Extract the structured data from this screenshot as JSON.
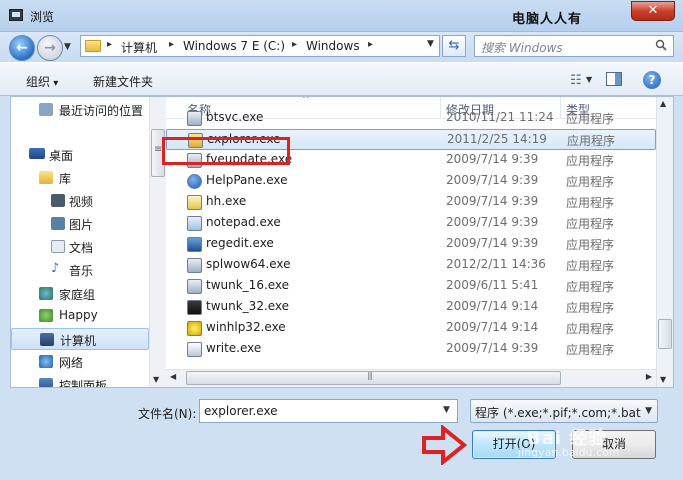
{
  "window": {
    "title": "浏览",
    "watermark_title": "电脑人人有",
    "close_label": "✕"
  },
  "address": {
    "crumbs": [
      "计算机",
      "Windows 7 E (C:)",
      "Windows"
    ],
    "search_placeholder": "搜索 Windows"
  },
  "toolbar": {
    "organize_label": "组织",
    "new_folder_label": "新建文件夹"
  },
  "nav": {
    "items": [
      {
        "label": "最近访问的位置",
        "icon": "recent-places-icon"
      },
      {
        "label": "桌面",
        "icon": "desktop-icon"
      },
      {
        "label": "库",
        "icon": "libraries-icon"
      },
      {
        "label": "视频",
        "icon": "videos-icon"
      },
      {
        "label": "图片",
        "icon": "pictures-icon"
      },
      {
        "label": "文档",
        "icon": "documents-icon"
      },
      {
        "label": "音乐",
        "icon": "music-icon"
      },
      {
        "label": "家庭组",
        "icon": "homegroup-icon"
      },
      {
        "label": "Happy",
        "icon": "user-icon"
      },
      {
        "label": "计算机",
        "icon": "computer-icon"
      },
      {
        "label": "网络",
        "icon": "network-icon"
      },
      {
        "label": "控制面板",
        "icon": "control-panel-icon"
      }
    ]
  },
  "columns": {
    "name": "名称",
    "date": "修改日期",
    "type": "类型"
  },
  "files": [
    {
      "name": "btsvc.exe",
      "date": "2010/11/21 11:24",
      "type": "应用程序",
      "icon": "app-icon"
    },
    {
      "name": "explorer.exe",
      "date": "2011/2/25 14:19",
      "type": "应用程序",
      "icon": "folder-explorer-icon"
    },
    {
      "name": "fveupdate.exe",
      "date": "2009/7/14 9:39",
      "type": "应用程序",
      "icon": "app-icon"
    },
    {
      "name": "HelpPane.exe",
      "date": "2009/7/14 9:39",
      "type": "应用程序",
      "icon": "help-icon"
    },
    {
      "name": "hh.exe",
      "date": "2009/7/14 9:39",
      "type": "应用程序",
      "icon": "help-doc-icon"
    },
    {
      "name": "notepad.exe",
      "date": "2009/7/14 9:39",
      "type": "应用程序",
      "icon": "notepad-icon"
    },
    {
      "name": "regedit.exe",
      "date": "2009/7/14 9:39",
      "type": "应用程序",
      "icon": "regedit-icon"
    },
    {
      "name": "splwow64.exe",
      "date": "2012/2/11 14:36",
      "type": "应用程序",
      "icon": "app-icon"
    },
    {
      "name": "twunk_16.exe",
      "date": "2009/6/11 5:41",
      "type": "应用程序",
      "icon": "app-icon"
    },
    {
      "name": "twunk_32.exe",
      "date": "2009/7/14 9:14",
      "type": "应用程序",
      "icon": "twain-icon"
    },
    {
      "name": "winhlp32.exe",
      "date": "2009/7/14 9:14",
      "type": "应用程序",
      "icon": "winhelp-icon"
    },
    {
      "name": "write.exe",
      "date": "2009/7/14 9:39",
      "type": "应用程序",
      "icon": "wordpad-icon"
    }
  ],
  "bottom": {
    "filename_label": "文件名(N):",
    "filename_value": "explorer.exe",
    "filter_value": "程序 (*.exe;*.pif;*.com;*.bat;*.",
    "open_label": "打开(O)",
    "cancel_label": "取消"
  },
  "watermark": {
    "brand": "Bai 经验",
    "url": "jingyan.baidu.com"
  },
  "colors": {
    "highlight_box": "#d22222",
    "selection": "#d7e7f8",
    "accent": "#2d66b8"
  }
}
